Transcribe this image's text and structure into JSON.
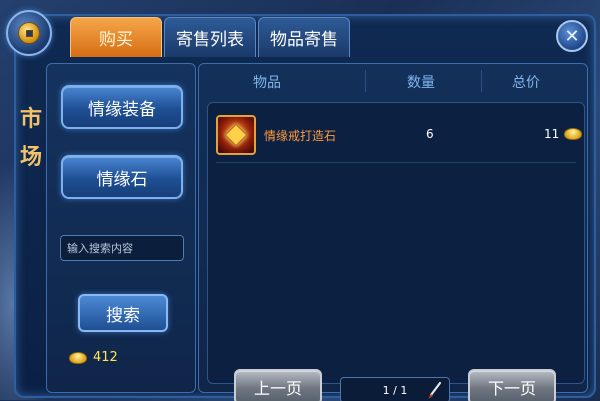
{
  "tabs": [
    {
      "label": "购买",
      "active": true
    },
    {
      "label": "寄售列表",
      "active": false
    },
    {
      "label": "物品寄售",
      "active": false
    }
  ],
  "icons": {
    "coin": "coin-icon",
    "close": "close-icon",
    "ingot": "gold-ingot-icon",
    "item": "gem-icon",
    "edit": "brush-icon"
  },
  "sidebar": {
    "title": "市场",
    "categories": [
      {
        "label": "情缘装备"
      },
      {
        "label": "情缘石"
      }
    ],
    "search_placeholder": "输入搜索内容",
    "search_button": "搜索",
    "balance": "412"
  },
  "table": {
    "headers": {
      "item": "物品",
      "quantity": "数量",
      "price": "总价"
    },
    "rows": [
      {
        "name": "情缘戒打造石",
        "quantity": "6",
        "price": "11"
      }
    ]
  },
  "pagination": {
    "prev_label": "上一页",
    "next_label": "下一页",
    "page_text": "1 / 1"
  },
  "colors": {
    "accent_tab": "#e8861e",
    "item_name": "#ff9a3c",
    "header_text": "#7fb6ec",
    "balance_text": "#ffe45a"
  }
}
